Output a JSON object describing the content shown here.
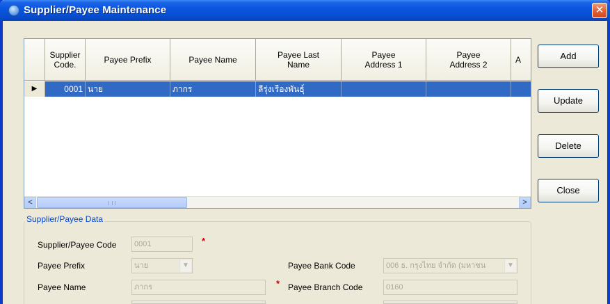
{
  "window": {
    "title": "Supplier/Payee Maintenance",
    "close_glyph": "✕"
  },
  "grid": {
    "columns": [
      {
        "label": "Supplier\nCode."
      },
      {
        "label": "Payee Prefix"
      },
      {
        "label": "Payee Name"
      },
      {
        "label": "Payee Last\nName"
      },
      {
        "label": "Payee\nAddress 1"
      },
      {
        "label": "Payee\nAddress 2"
      },
      {
        "label": "A"
      }
    ],
    "rows": [
      {
        "indicator": "▶",
        "supplier_code": "0001",
        "payee_prefix": "นาย",
        "payee_name": "ภากร",
        "payee_last_name": "ลีรุ่งเรืองพันธุ์",
        "payee_address_1": "",
        "payee_address_2": "",
        "payee_address_3": ""
      }
    ],
    "scroll_left_glyph": "<",
    "scroll_right_glyph": ">"
  },
  "buttons": {
    "add": "Add",
    "update": "Update",
    "delete": "Delete",
    "close": "Close"
  },
  "form": {
    "group_title": "Supplier/Payee Data",
    "supplier_payee_code": {
      "label": "Supplier/Payee Code",
      "value": "0001",
      "required_mark": "*"
    },
    "payee_prefix": {
      "label": "Payee Prefix",
      "value": "นาย"
    },
    "payee_name": {
      "label": "Payee Name",
      "value": "ภากร",
      "required_mark": "*"
    },
    "payee_bank_code": {
      "label": "Payee Bank Code",
      "value": "006 ธ. กรุงไทย จำกัด (มหาชน"
    },
    "payee_branch_code": {
      "label": "Payee Branch Code",
      "value": "0160"
    }
  },
  "icons": {
    "app": "app-icon",
    "close": "close-icon",
    "row_indicator": "row-pointer-icon",
    "dropdown": "chevron-down-icon"
  },
  "colors": {
    "title_bar": "#0a55e0",
    "selection": "#316ac5",
    "required": "#d00000",
    "group_title": "#0046d5"
  }
}
